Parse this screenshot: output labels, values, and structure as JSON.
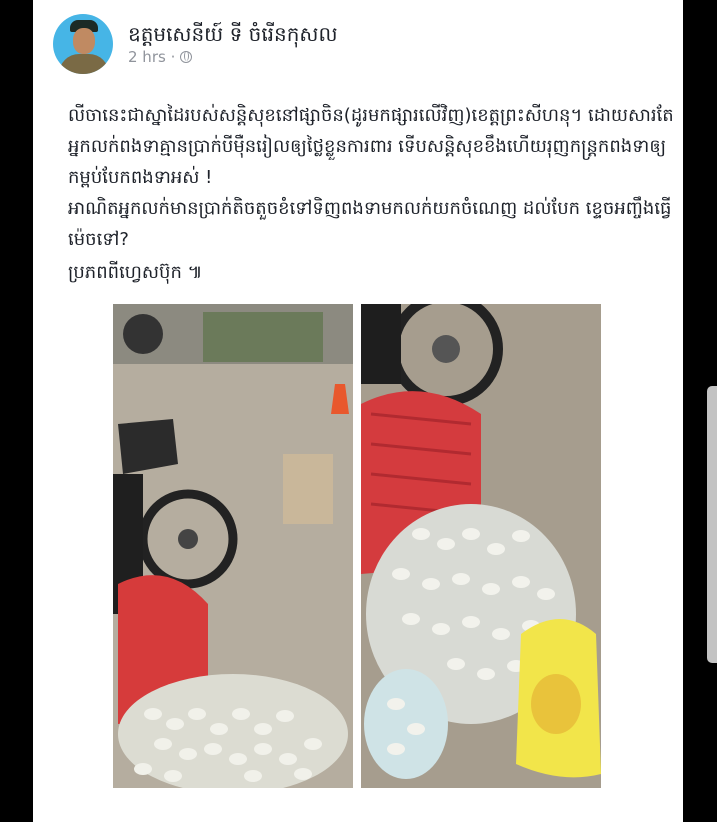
{
  "post": {
    "author": "ឧត្តមសេនីយ៍ ទី ចំរើនកុសល",
    "time": "2 hrs ·",
    "paragraphs": [
      "លីចានេះជាស្នាដៃរបស់សន្តិសុខនៅផ្សាចិន(ដូរមកផ្សារលើវិញ)ខេត្តព្រះសីហនុ។ ដោយសារតែអ្នកលក់ពងទាគ្មានប្រាក់បីម៉ឺនរៀលឲ្យថ្លៃខ្លួនការពារ ទើបសន្តិសុខខឹងហើយរុញកន្ត្រកពងទាឲ្យកម្ពប់បែកពងទាអស់ !",
      "អាណិតអ្នកលក់មានប្រាក់តិចតួចខំទៅទិញពងទាមកលក់យកចំណេញ ដល់បែក ខ្ទេចអញ្ចឹងធ្វើម៉េចទៅ?"
    ],
    "source": "ប្រភពពីហ្វេសប៊ុក ៕"
  },
  "icons": {
    "privacy": "globe-icon"
  },
  "photos": [
    {
      "alt": "broken duck eggs spilled from basket near motorbike"
    },
    {
      "alt": "close-up of spilled duck eggs and red basket"
    }
  ]
}
